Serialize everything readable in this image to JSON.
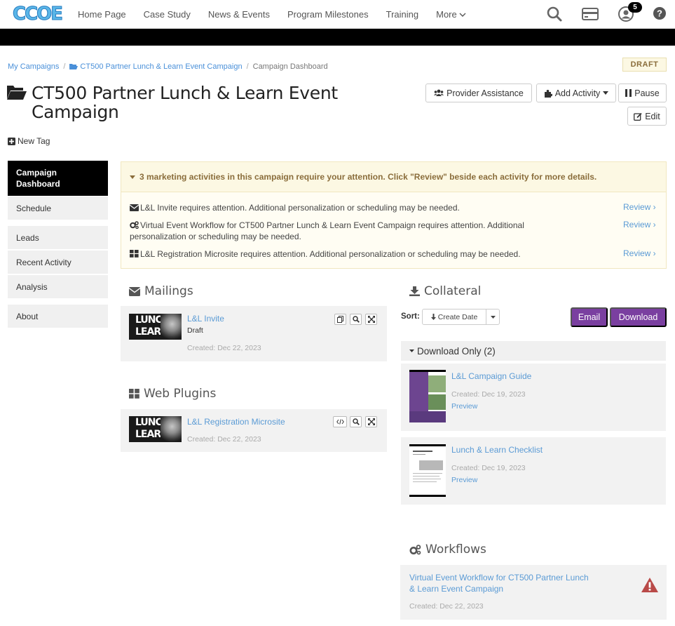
{
  "app": {
    "logo_text": "CCOE"
  },
  "nav": {
    "links": [
      "Home Page",
      "Case Study",
      "News & Events",
      "Program Milestones",
      "Training"
    ],
    "more_label": "More",
    "notification_count": "5"
  },
  "breadcrumb": {
    "items": [
      "My Campaigns",
      "CT500 Partner Lunch & Learn Event Campaign",
      "Campaign Dashboard"
    ]
  },
  "status_badge": "DRAFT",
  "page_title": "CT500 Partner Lunch & Learn Event Campaign",
  "header_buttons": {
    "provider_assistance": "Provider Assistance",
    "add_activity": "Add Activity",
    "pause": "Pause",
    "edit": "Edit"
  },
  "new_tag_label": "New Tag",
  "sidebar": {
    "items": [
      "Campaign Dashboard",
      "Schedule",
      "Leads",
      "Recent Activity",
      "Analysis",
      "About"
    ]
  },
  "alert": {
    "heading": "3 marketing activities in this campaign require your attention. Click \"Review\" beside each activity for more details.",
    "rows": [
      {
        "text": "L&L Invite requires attention. Additional personalization or scheduling may be needed.",
        "action": "Review ›"
      },
      {
        "text": "Virtual Event Workflow for CT500 Partner Lunch & Learn Event Campaign requires attention. Additional personalization or scheduling may be needed.",
        "action": "Review ›"
      },
      {
        "text": "L&L Registration Microsite requires attention. Additional personalization or scheduling may be needed.",
        "action": "Review ›"
      }
    ]
  },
  "thumbnail_text": [
    "LUNCH",
    "LEARN"
  ],
  "mailings": {
    "title": "Mailings",
    "items": [
      {
        "name": "L&L Invite",
        "status": "Draft",
        "created": "Created: Dec 22, 2023"
      }
    ]
  },
  "web_plugins": {
    "title": "Web Plugins",
    "items": [
      {
        "name": "L&L Registration Microsite",
        "created": "Created: Dec 22, 2023"
      }
    ]
  },
  "collateral": {
    "title": "Collateral",
    "sort_label": "Sort:",
    "sort_value": "Create Date",
    "email_button": "Email",
    "download_button": "Download",
    "group_label": "Download Only (2)",
    "items": [
      {
        "name": "L&L Campaign Guide",
        "created": "Created: Dec 19, 2023",
        "preview": "Preview"
      },
      {
        "name": "Lunch & Learn Checklist",
        "created": "Created: Dec 19, 2023",
        "preview": "Preview"
      }
    ]
  },
  "workflows": {
    "title": "Workflows",
    "items": [
      {
        "name": "Virtual Event Workflow for CT500 Partner Lunch & Learn Event Campaign",
        "created": "Created: Dec 22, 2023"
      }
    ]
  },
  "colors": {
    "accent_purple": "#7a3fa0",
    "link_blue": "#5b9bd5",
    "warning_red": "#b94a48"
  }
}
